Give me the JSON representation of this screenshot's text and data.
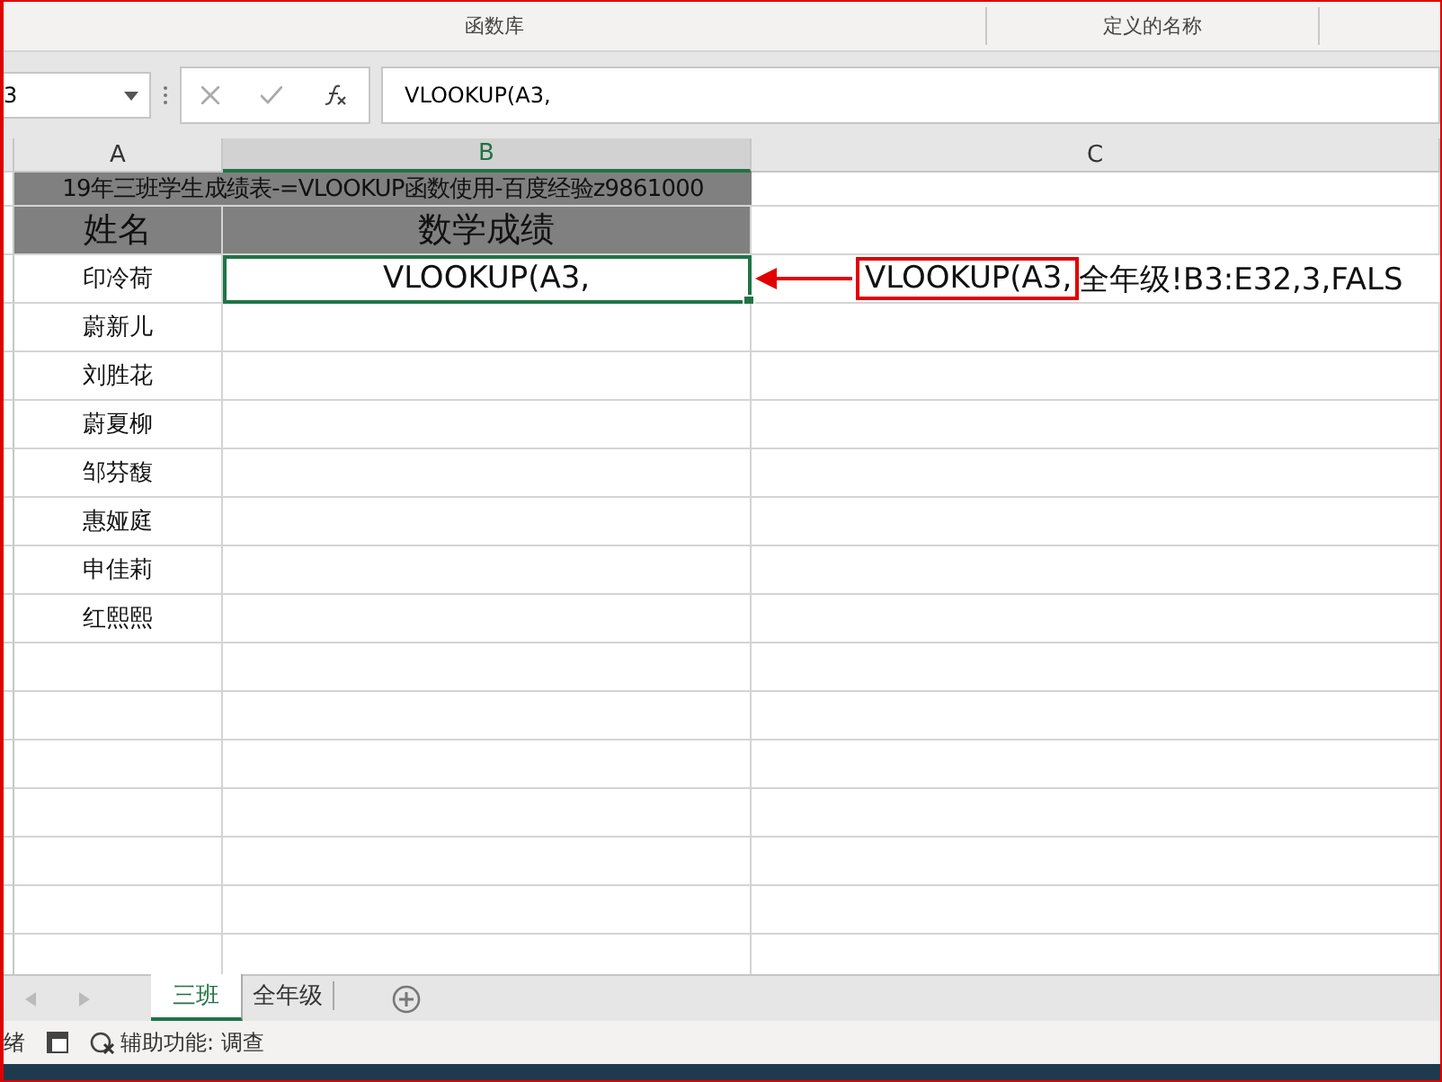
{
  "ribbon": {
    "groups": [
      "函数库",
      "定义的名称"
    ]
  },
  "formula_bar": {
    "name_box": "3",
    "formula": "VLOOKUP(A3,"
  },
  "columns": [
    {
      "label": "A",
      "selected": false
    },
    {
      "label": "B",
      "selected": true
    },
    {
      "label": "C",
      "selected": false
    }
  ],
  "title": "19年三班学生成绩表-=VLOOKUP函数使用-百度经验z9861000",
  "headers": [
    "姓名",
    "数学成绩"
  ],
  "rows": [
    {
      "name": "印冷荷",
      "score": "VLOOKUP(A3,",
      "selected": true
    },
    {
      "name": "蔚新儿",
      "selected": false
    },
    {
      "name": "刘胜花",
      "selected": false
    },
    {
      "name": "蔚夏柳",
      "selected": false
    },
    {
      "name": "邹芬馥",
      "selected": false
    },
    {
      "name": "惠娅庭",
      "selected": false
    },
    {
      "name": "申佳莉",
      "selected": false
    },
    {
      "name": "红熙熙",
      "selected": false
    }
  ],
  "annotation": {
    "highlight": "VLOOKUP(A3,",
    "rest": "全年级!B3:E32,3,FALS"
  },
  "sheet_tabs": [
    {
      "label": "三班",
      "selected": true
    },
    {
      "label": "全年级",
      "selected": false
    }
  ],
  "status_bar": {
    "mode": "绪",
    "accessibility": "辅助功能: 调查"
  }
}
